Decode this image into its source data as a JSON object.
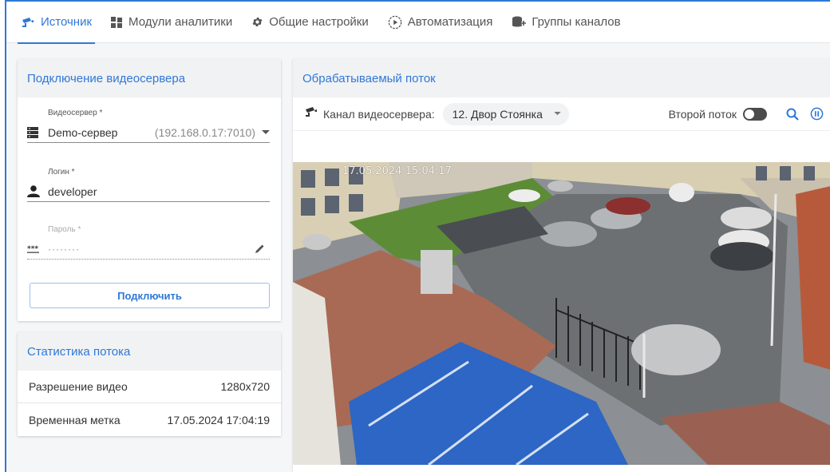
{
  "tabs": [
    {
      "label": "Источник",
      "icon": "camera-icon",
      "active": true
    },
    {
      "label": "Модули аналитики",
      "icon": "modules-icon",
      "active": false
    },
    {
      "label": "Общие настройки",
      "icon": "gear-icon",
      "active": false
    },
    {
      "label": "Автоматизация",
      "icon": "play-circle-icon",
      "active": false
    },
    {
      "label": "Группы каналов",
      "icon": "channel-group-icon",
      "active": false
    }
  ],
  "connection": {
    "title": "Подключение видеосервера",
    "server_label": "Видеосервер *",
    "server_value": "Demo-сервер",
    "server_address": "(192.168.0.17:7010)",
    "login_label": "Логин *",
    "login_value": "developer",
    "password_label": "Пароль *",
    "password_value": "········",
    "connect_button": "Подключить"
  },
  "stats": {
    "title": "Статистика потока",
    "rows": [
      {
        "label": "Разрешение видео",
        "value": "1280x720"
      },
      {
        "label": "Временная метка",
        "value": "17.05.2024 17:04:19"
      }
    ]
  },
  "stream": {
    "title": "Обрабатываемый поток",
    "channel_label": "Канал видеосервера:",
    "channel_value": "12. Двор Стоянка",
    "second_stream_label": "Второй поток",
    "second_stream_on": false,
    "video_timestamp": "17.05.2024 15:04:17"
  },
  "colors": {
    "accent": "#2f78d6",
    "header_bg": "#f1f2f4"
  }
}
